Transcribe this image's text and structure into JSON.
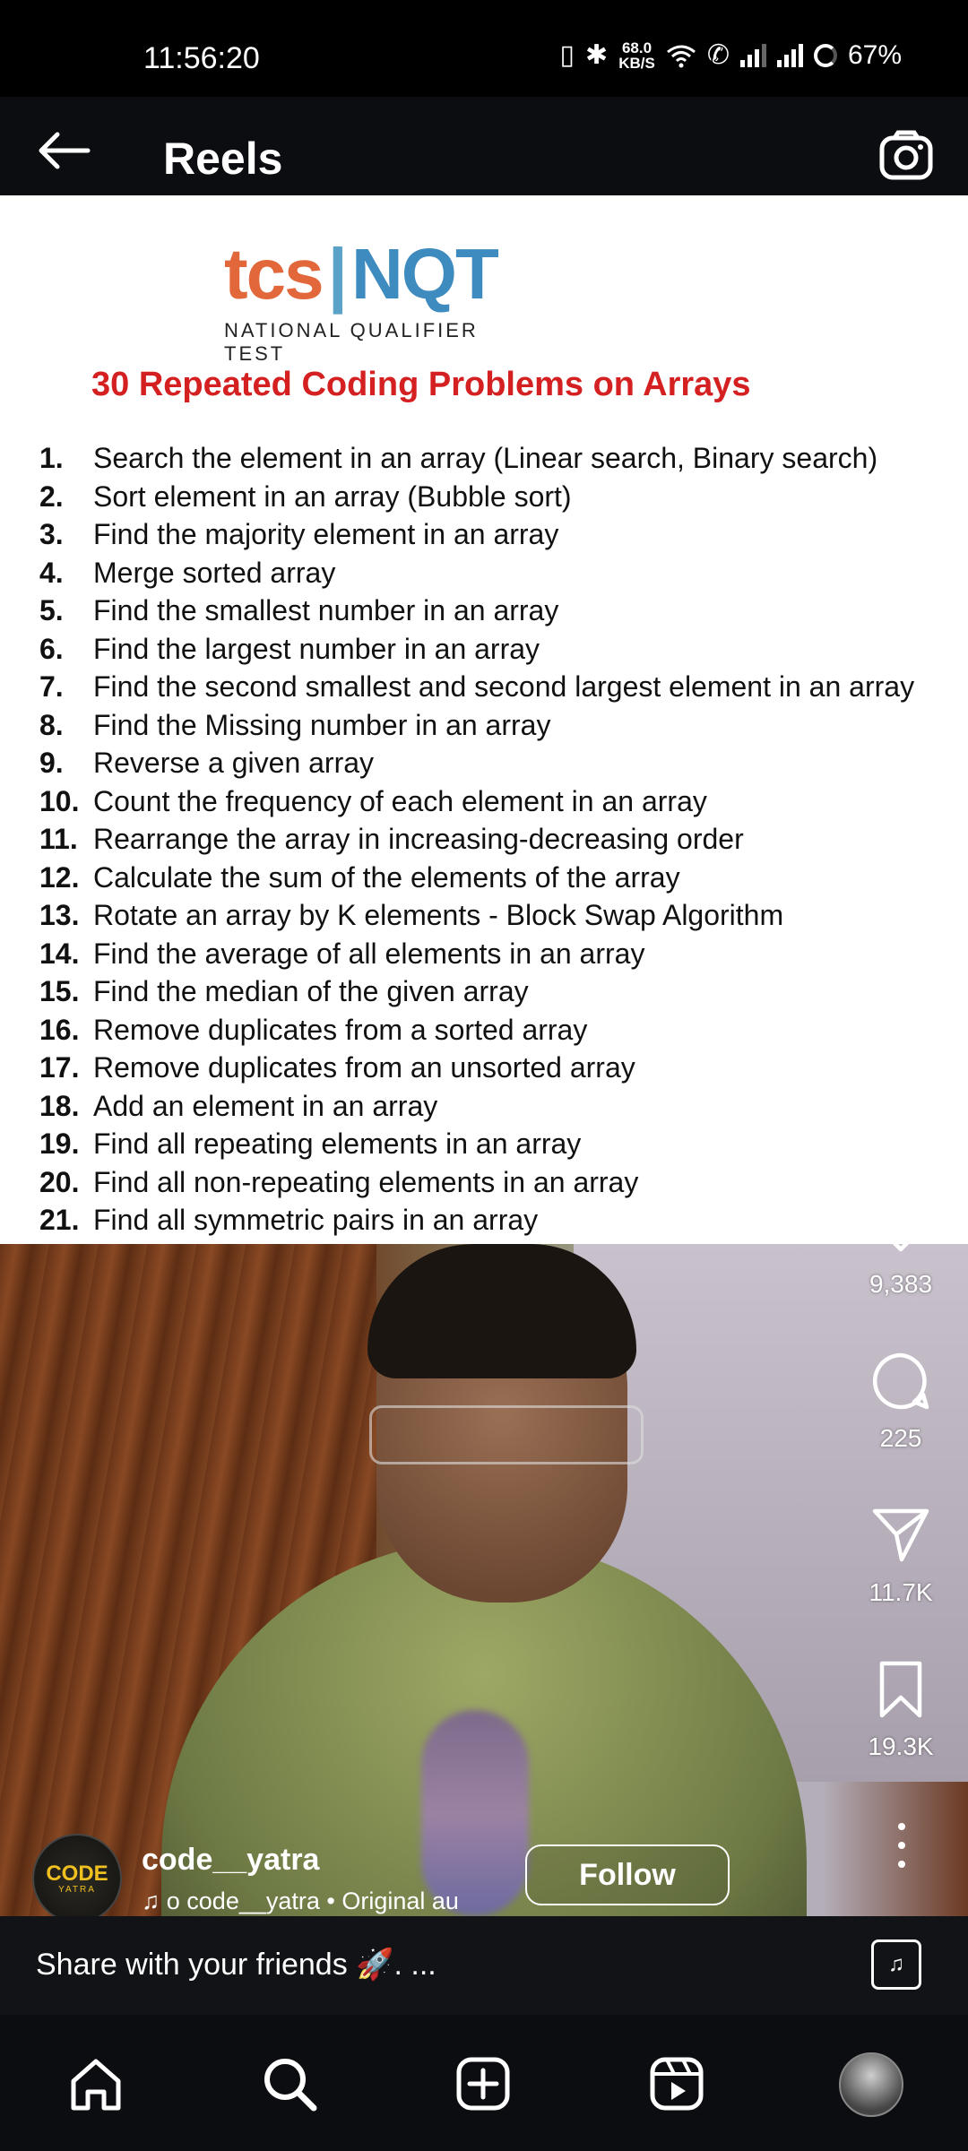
{
  "status_bar": {
    "time": "11:56:20",
    "net_speed_value": "68.0",
    "net_speed_unit": "KB/S",
    "battery": "67%"
  },
  "header": {
    "title": "Reels"
  },
  "document": {
    "logo_text_left": "tcs",
    "logo_text_right": "NQT",
    "logo_subtitle": "NATIONAL QUALIFIER TEST",
    "heading": "30 Repeated Coding Problems on Arrays",
    "problems": [
      {
        "num": "1.",
        "text": "Search the element in an array (Linear search, Binary search)"
      },
      {
        "num": "2.",
        "text": "Sort element in an array (Bubble sort)"
      },
      {
        "num": "3.",
        "text": "Find the majority element in an array"
      },
      {
        "num": "4.",
        "text": "Merge sorted array"
      },
      {
        "num": "5.",
        "text": "Find the smallest number in an array"
      },
      {
        "num": "6.",
        "text": "Find the largest number in an array"
      },
      {
        "num": "7.",
        "text": "Find the second smallest and second largest element in an array"
      },
      {
        "num": "8.",
        "text": "Find the Missing number in an array"
      },
      {
        "num": "9.",
        "text": "Reverse a given array"
      },
      {
        "num": "10.",
        "text": "Count the frequency of each element in an array"
      },
      {
        "num": "11.",
        "text": "Rearrange the array in increasing-decreasing order"
      },
      {
        "num": "12.",
        "text": "Calculate the sum of the elements of the array"
      },
      {
        "num": "13.",
        "text": "Rotate an array by K elements - Block Swap Algorithm"
      },
      {
        "num": "14.",
        "text": "Find the average of all elements in an array"
      },
      {
        "num": "15.",
        "text": "Find the median of the given array"
      },
      {
        "num": "16.",
        "text": "Remove duplicates from a sorted array"
      },
      {
        "num": "17.",
        "text": "Remove duplicates from an unsorted array"
      },
      {
        "num": "18.",
        "text": "Add an element in an array"
      },
      {
        "num": "19.",
        "text": "Find all repeating elements in an array"
      },
      {
        "num": "20.",
        "text": "Find all non-repeating elements in an array"
      },
      {
        "num": "21.",
        "text": "Find all symmetric pairs in an array"
      }
    ]
  },
  "actions": {
    "likes": "9,383",
    "comments": "225",
    "shares": "11.7K",
    "saves": "19.3K"
  },
  "author": {
    "avatar_text_top": "CODE",
    "avatar_text_bottom": "YATRA",
    "username": "code__yatra",
    "audio": "o    code__yatra • Original au",
    "follow_label": "Follow"
  },
  "caption": {
    "text": "Share with your friends 🚀. ..."
  },
  "icons": {
    "back": "arrow-left-icon",
    "camera": "camera-icon",
    "like": "heart-icon",
    "comment": "comment-icon",
    "share": "send-icon",
    "save": "bookmark-icon",
    "more": "more-vertical-icon",
    "home": "home-icon",
    "search": "search-icon",
    "create": "plus-square-icon",
    "reels": "reels-icon"
  }
}
